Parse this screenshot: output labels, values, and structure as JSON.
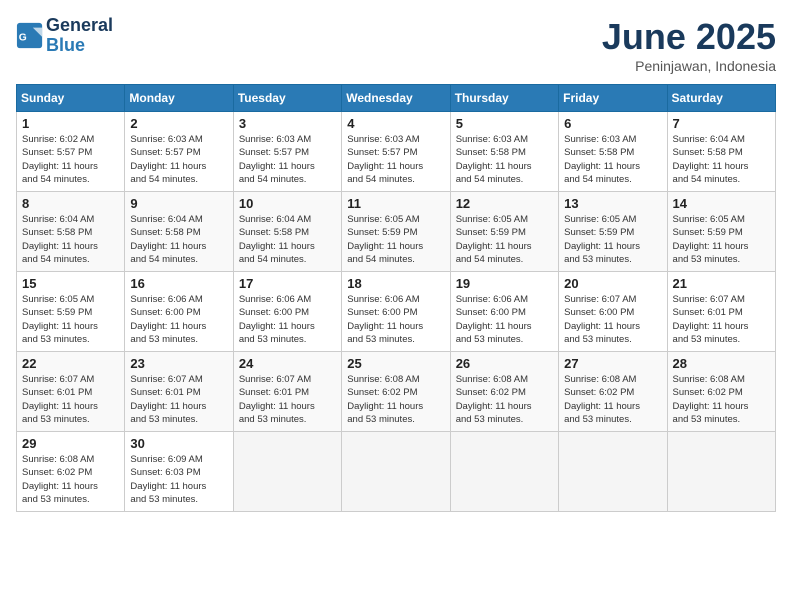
{
  "logo": {
    "line1": "General",
    "line2": "Blue"
  },
  "title": "June 2025",
  "subtitle": "Peninjawan, Indonesia",
  "days_header": [
    "Sunday",
    "Monday",
    "Tuesday",
    "Wednesday",
    "Thursday",
    "Friday",
    "Saturday"
  ],
  "weeks": [
    [
      {
        "num": "1",
        "rise": "6:02 AM",
        "set": "5:57 PM",
        "hours": "11",
        "mins": "54"
      },
      {
        "num": "2",
        "rise": "6:03 AM",
        "set": "5:57 PM",
        "hours": "11",
        "mins": "54"
      },
      {
        "num": "3",
        "rise": "6:03 AM",
        "set": "5:57 PM",
        "hours": "11",
        "mins": "54"
      },
      {
        "num": "4",
        "rise": "6:03 AM",
        "set": "5:57 PM",
        "hours": "11",
        "mins": "54"
      },
      {
        "num": "5",
        "rise": "6:03 AM",
        "set": "5:58 PM",
        "hours": "11",
        "mins": "54"
      },
      {
        "num": "6",
        "rise": "6:03 AM",
        "set": "5:58 PM",
        "hours": "11",
        "mins": "54"
      },
      {
        "num": "7",
        "rise": "6:04 AM",
        "set": "5:58 PM",
        "hours": "11",
        "mins": "54"
      }
    ],
    [
      {
        "num": "8",
        "rise": "6:04 AM",
        "set": "5:58 PM",
        "hours": "11",
        "mins": "54"
      },
      {
        "num": "9",
        "rise": "6:04 AM",
        "set": "5:58 PM",
        "hours": "11",
        "mins": "54"
      },
      {
        "num": "10",
        "rise": "6:04 AM",
        "set": "5:58 PM",
        "hours": "11",
        "mins": "54"
      },
      {
        "num": "11",
        "rise": "6:05 AM",
        "set": "5:59 PM",
        "hours": "11",
        "mins": "54"
      },
      {
        "num": "12",
        "rise": "6:05 AM",
        "set": "5:59 PM",
        "hours": "11",
        "mins": "54"
      },
      {
        "num": "13",
        "rise": "6:05 AM",
        "set": "5:59 PM",
        "hours": "11",
        "mins": "53"
      },
      {
        "num": "14",
        "rise": "6:05 AM",
        "set": "5:59 PM",
        "hours": "11",
        "mins": "53"
      }
    ],
    [
      {
        "num": "15",
        "rise": "6:05 AM",
        "set": "5:59 PM",
        "hours": "11",
        "mins": "53"
      },
      {
        "num": "16",
        "rise": "6:06 AM",
        "set": "6:00 PM",
        "hours": "11",
        "mins": "53"
      },
      {
        "num": "17",
        "rise": "6:06 AM",
        "set": "6:00 PM",
        "hours": "11",
        "mins": "53"
      },
      {
        "num": "18",
        "rise": "6:06 AM",
        "set": "6:00 PM",
        "hours": "11",
        "mins": "53"
      },
      {
        "num": "19",
        "rise": "6:06 AM",
        "set": "6:00 PM",
        "hours": "11",
        "mins": "53"
      },
      {
        "num": "20",
        "rise": "6:07 AM",
        "set": "6:00 PM",
        "hours": "11",
        "mins": "53"
      },
      {
        "num": "21",
        "rise": "6:07 AM",
        "set": "6:01 PM",
        "hours": "11",
        "mins": "53"
      }
    ],
    [
      {
        "num": "22",
        "rise": "6:07 AM",
        "set": "6:01 PM",
        "hours": "11",
        "mins": "53"
      },
      {
        "num": "23",
        "rise": "6:07 AM",
        "set": "6:01 PM",
        "hours": "11",
        "mins": "53"
      },
      {
        "num": "24",
        "rise": "6:07 AM",
        "set": "6:01 PM",
        "hours": "11",
        "mins": "53"
      },
      {
        "num": "25",
        "rise": "6:08 AM",
        "set": "6:02 PM",
        "hours": "11",
        "mins": "53"
      },
      {
        "num": "26",
        "rise": "6:08 AM",
        "set": "6:02 PM",
        "hours": "11",
        "mins": "53"
      },
      {
        "num": "27",
        "rise": "6:08 AM",
        "set": "6:02 PM",
        "hours": "11",
        "mins": "53"
      },
      {
        "num": "28",
        "rise": "6:08 AM",
        "set": "6:02 PM",
        "hours": "11",
        "mins": "53"
      }
    ],
    [
      {
        "num": "29",
        "rise": "6:08 AM",
        "set": "6:02 PM",
        "hours": "11",
        "mins": "53"
      },
      {
        "num": "30",
        "rise": "6:09 AM",
        "set": "6:03 PM",
        "hours": "11",
        "mins": "53"
      },
      null,
      null,
      null,
      null,
      null
    ]
  ]
}
